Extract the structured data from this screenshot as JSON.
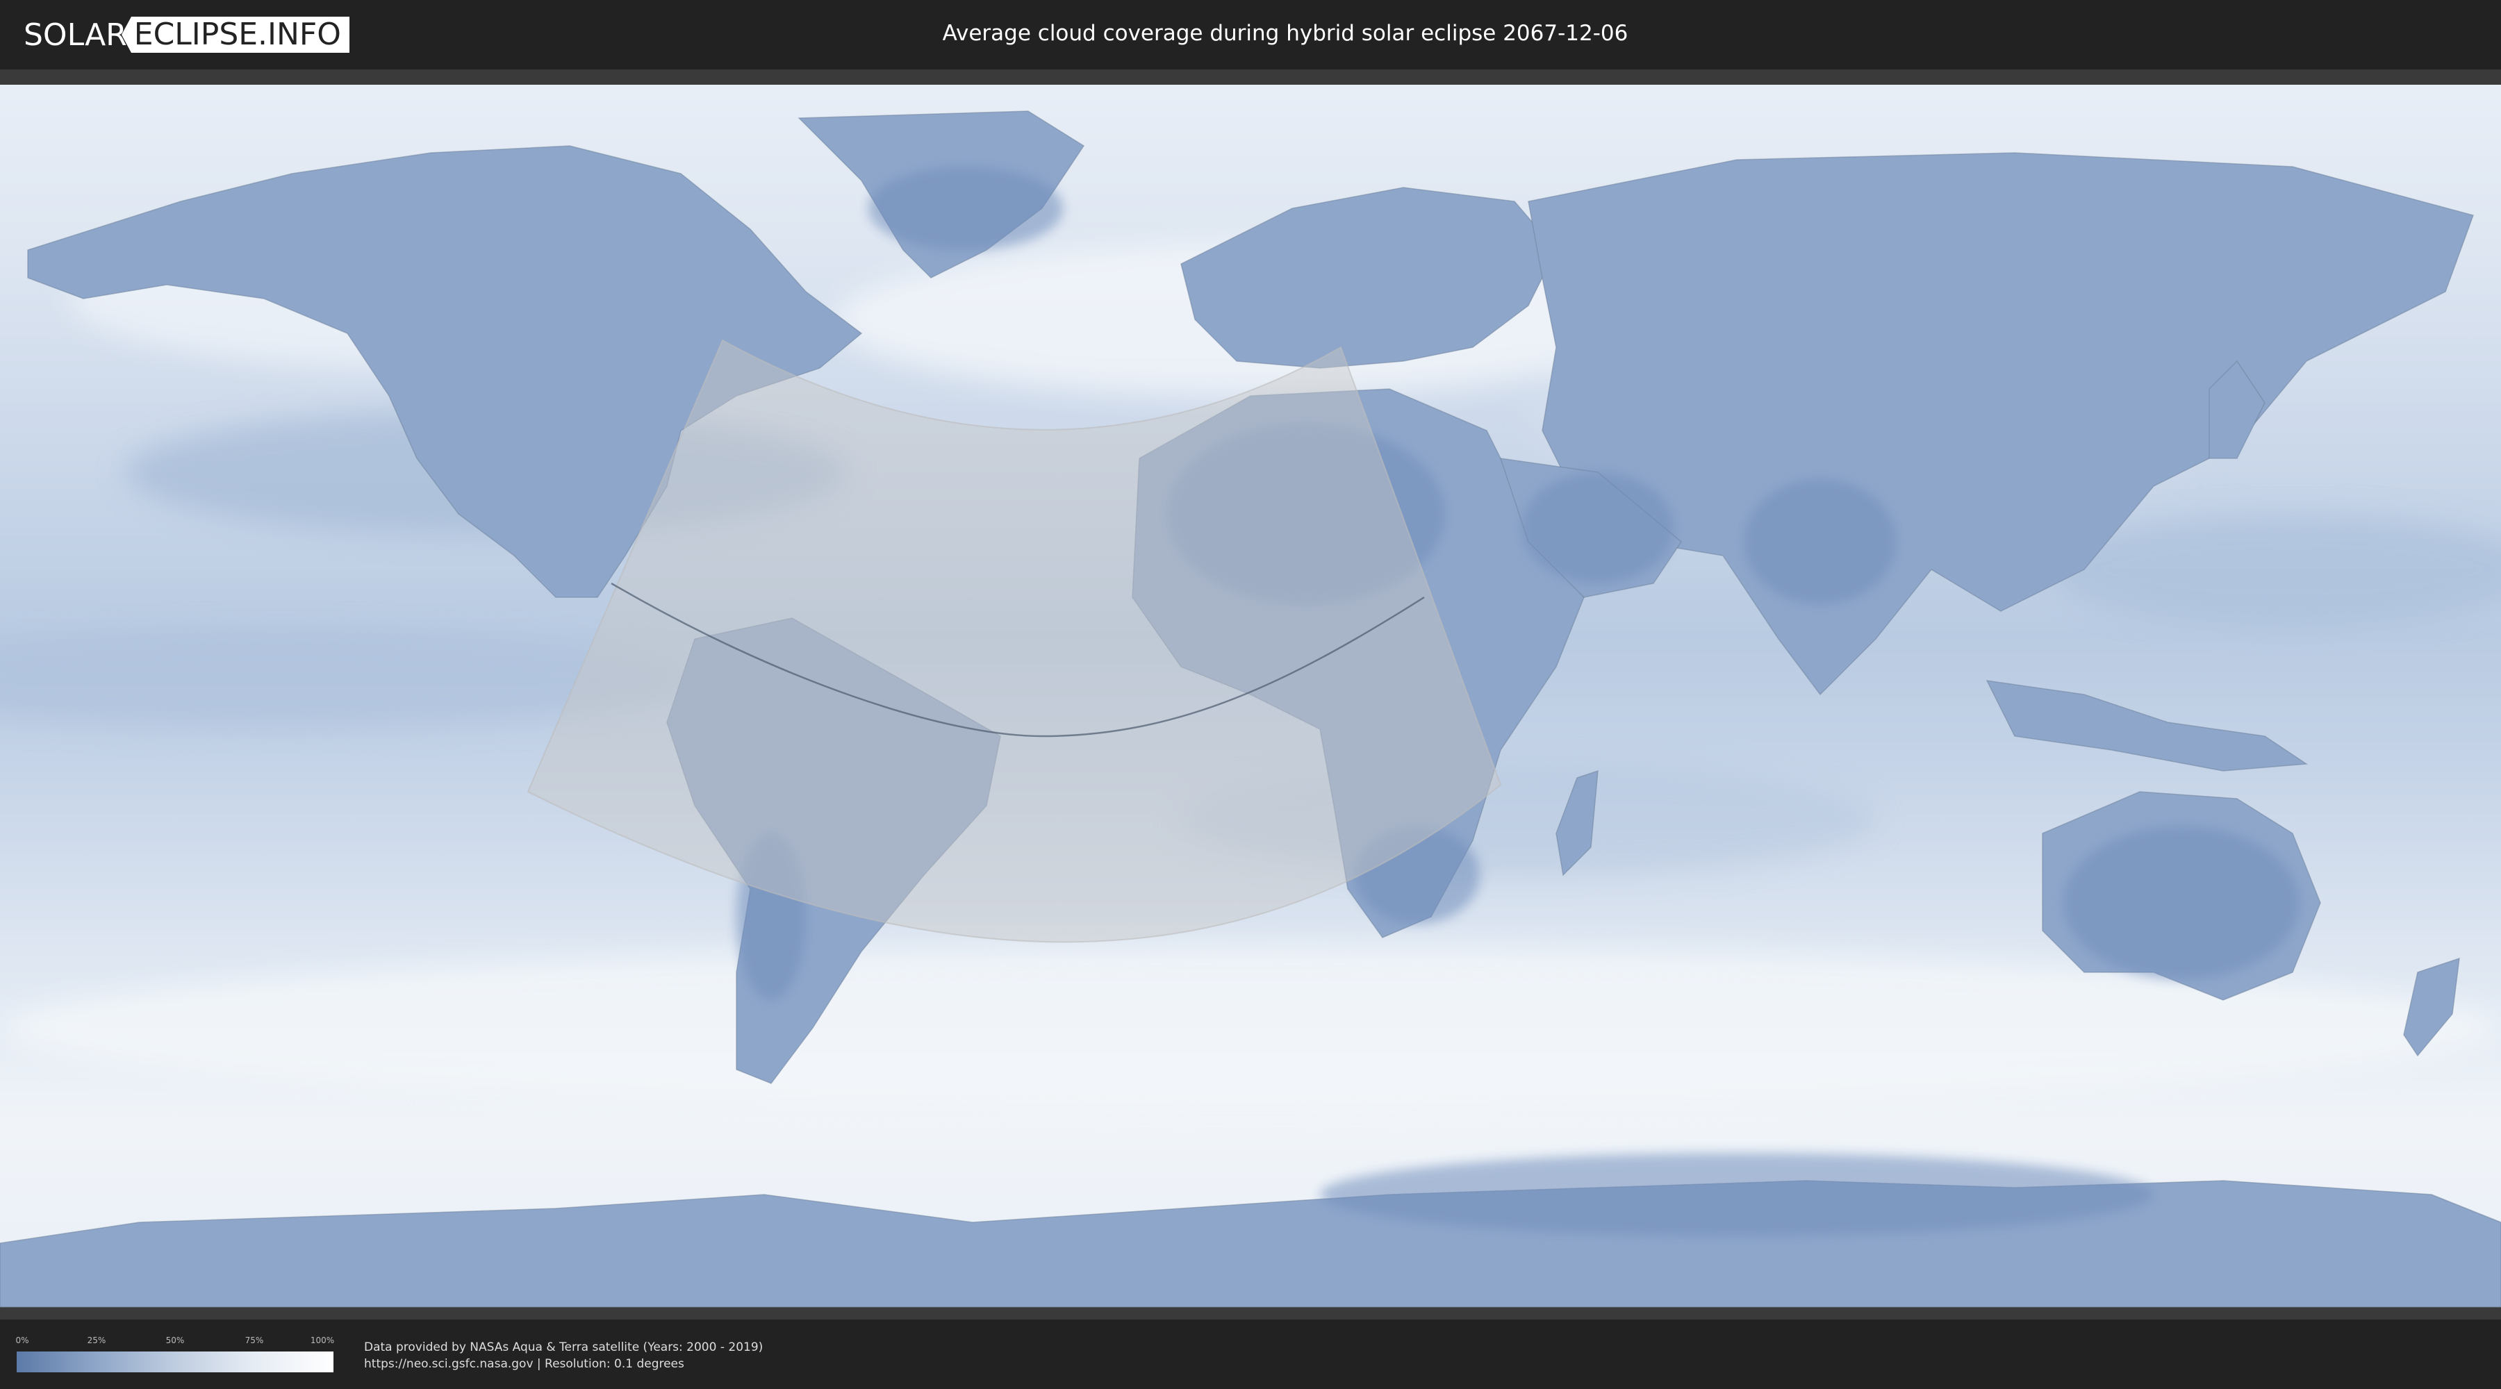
{
  "header": {
    "logo_left": "SOLAR",
    "logo_right": "ECLIPSE.INFO",
    "title": "Average cloud coverage during hybrid solar eclipse 2067-12-06"
  },
  "map": {
    "ocean_color": "#a9bcd8",
    "land_color": "#7f9cc6",
    "cloud_color": "#f4f7fb",
    "path_color": "#bdbdbd",
    "eclipse_path_description_icon": "eclipse-visibility-region"
  },
  "legend": {
    "ticks": [
      "0%",
      "25%",
      "50%",
      "75%",
      "100%"
    ],
    "colors": [
      "#5c7aa8",
      "#8ea6c8",
      "#bfcde0",
      "#e6ecf4",
      "#ffffff"
    ]
  },
  "credits": {
    "line1": "Data provided by NASAs Aqua & Terra satellite (Years: 2000 - 2019)",
    "line2": "https://neo.sci.gsfc.nasa.gov | Resolution: 0.1 degrees"
  }
}
